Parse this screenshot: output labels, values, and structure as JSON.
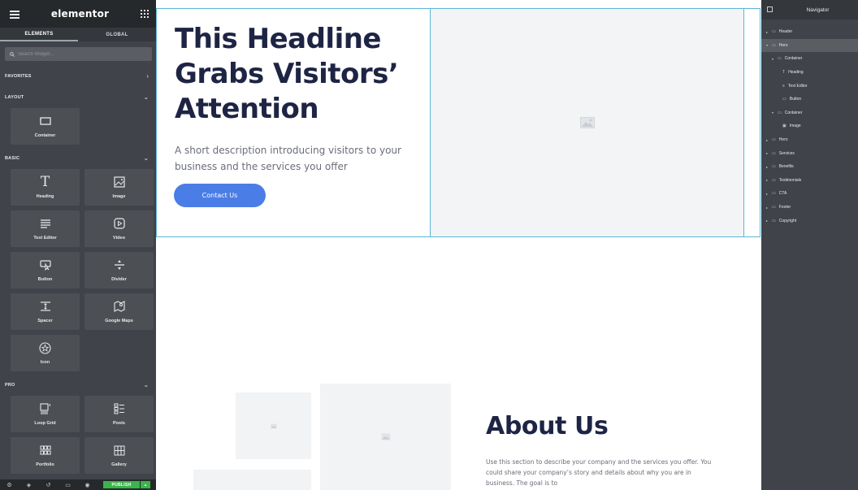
{
  "left_panel": {
    "brand": "elementor",
    "tabs": [
      "ELEMENTS",
      "GLOBAL"
    ],
    "search_placeholder": "Search Widget...",
    "sections": {
      "favorites": "FAVORITES",
      "layout": "LAYOUT",
      "basic": "BASIC",
      "pro": "PRO"
    },
    "layout_widgets": [
      {
        "label": "Container",
        "icon": "container-icon"
      }
    ],
    "basic_widgets": [
      {
        "label": "Heading",
        "icon": "heading-icon"
      },
      {
        "label": "Image",
        "icon": "image-icon"
      },
      {
        "label": "Text Editor",
        "icon": "text-editor-icon"
      },
      {
        "label": "Video",
        "icon": "video-icon"
      },
      {
        "label": "Button",
        "icon": "button-icon"
      },
      {
        "label": "Divider",
        "icon": "divider-icon"
      },
      {
        "label": "Spacer",
        "icon": "spacer-icon"
      },
      {
        "label": "Google Maps",
        "icon": "map-icon"
      },
      {
        "label": "Icon",
        "icon": "star-icon"
      }
    ],
    "pro_widgets": [
      {
        "label": "Loop Grid",
        "icon": "loop-grid-icon"
      },
      {
        "label": "Posts",
        "icon": "posts-icon"
      },
      {
        "label": "Portfolio",
        "icon": "portfolio-icon"
      },
      {
        "label": "Gallery",
        "icon": "gallery-icon"
      }
    ],
    "footer": {
      "publish_label": "PUBLISH",
      "icons": [
        "settings-icon",
        "layers-icon",
        "history-icon",
        "responsive-icon",
        "preview-icon"
      ]
    }
  },
  "canvas": {
    "hero": {
      "headline": "This Headline Grabs Visitors’ Attention",
      "description": "A short description introducing visitors to your business and the services you offer",
      "button_label": "Contact Us"
    },
    "about": {
      "title": "About Us",
      "text": "Use this section to describe your company and the services you offer. You could share your company’s story and details about why you are in business. The goal is to"
    }
  },
  "navigator": {
    "title": "Navigator",
    "items": [
      {
        "label": "Header",
        "depth": 0,
        "expanded": false,
        "icon": "container-icon"
      },
      {
        "label": "Hero",
        "depth": 0,
        "expanded": true,
        "selected": true,
        "icon": "container-icon"
      },
      {
        "label": "Container",
        "depth": 1,
        "expanded": true,
        "icon": "container-icon"
      },
      {
        "label": "Heading",
        "depth": 2,
        "icon": "heading-icon"
      },
      {
        "label": "Text Editor",
        "depth": 2,
        "icon": "text-editor-icon"
      },
      {
        "label": "Button",
        "depth": 2,
        "icon": "button-icon"
      },
      {
        "label": "Container",
        "depth": 1,
        "expanded": true,
        "icon": "container-icon"
      },
      {
        "label": "Image",
        "depth": 2,
        "icon": "image-icon"
      },
      {
        "label": "Hero",
        "depth": 0,
        "expanded": false,
        "icon": "container-icon"
      },
      {
        "label": "Services",
        "depth": 0,
        "expanded": false,
        "icon": "container-icon"
      },
      {
        "label": "Benefits",
        "depth": 0,
        "expanded": false,
        "icon": "container-icon"
      },
      {
        "label": "Testimonials",
        "depth": 0,
        "expanded": false,
        "icon": "container-icon"
      },
      {
        "label": "CTA",
        "depth": 0,
        "expanded": false,
        "icon": "container-icon"
      },
      {
        "label": "Footer",
        "depth": 0,
        "expanded": false,
        "icon": "container-icon"
      },
      {
        "label": "Copyright",
        "depth": 0,
        "expanded": false,
        "icon": "container-icon"
      }
    ]
  },
  "colors": {
    "panel_bg": "#404349",
    "panel_header": "#26292c",
    "accent_button": "#4a7de6",
    "publish_green": "#39b54a",
    "selection_outline": "#5bb6d8",
    "heading_text": "#1e2444"
  }
}
